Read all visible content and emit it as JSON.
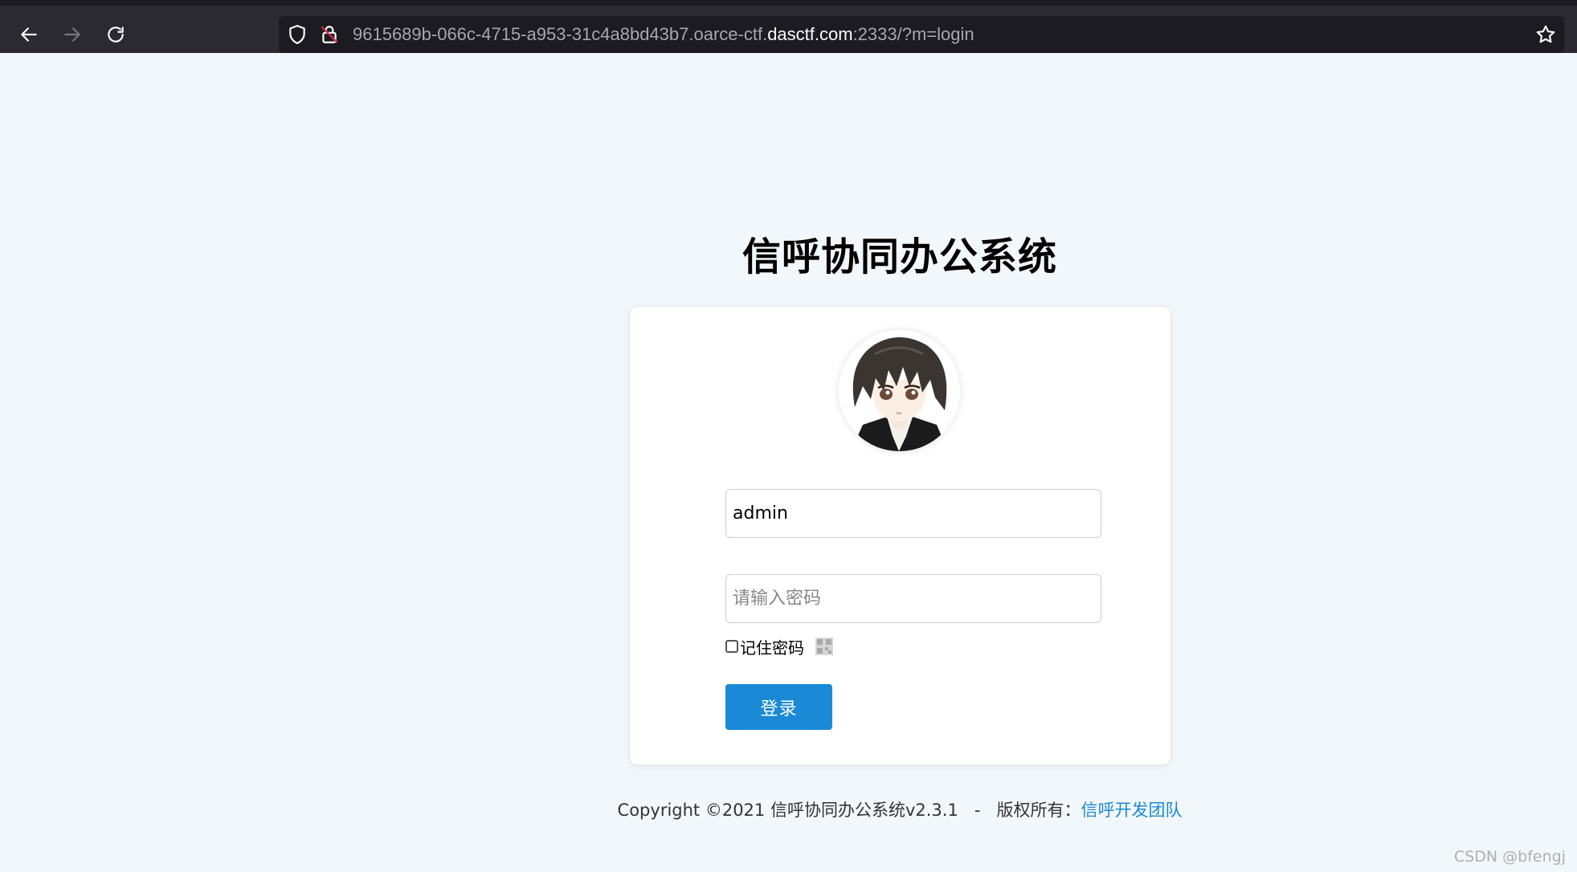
{
  "browser": {
    "url_prefix": "9615689b-066c-4715-a953-31c4a8bd43b7.oarce-ctf.",
    "url_domain": "dasctf.com",
    "url_suffix": ":2333/?m=login"
  },
  "page": {
    "title": "信呼协同办公系统"
  },
  "login": {
    "username_value": "admin",
    "password_placeholder": "请输入密码",
    "remember_label": "记住密码",
    "login_label": "登录"
  },
  "footer": {
    "copyright": "Copyright ©2021 信呼协同办公系统v2.3.1   -   版权所有：",
    "team": "信呼开发团队"
  },
  "watermark": "CSDN @bfengj",
  "colors": {
    "accent": "#1a8ad6",
    "background": "#f2f7fb",
    "toolbar": "#2b2a33"
  }
}
